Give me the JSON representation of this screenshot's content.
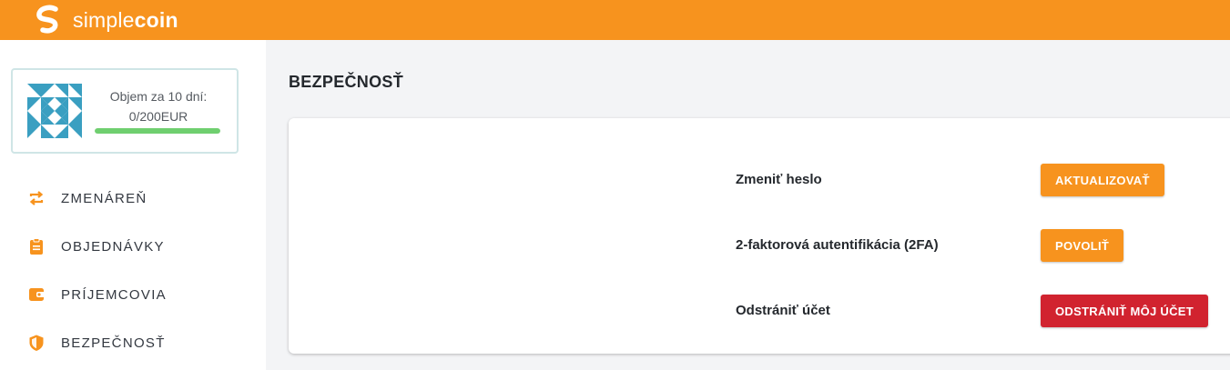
{
  "header": {
    "brand_light": "simple",
    "brand_bold": "coin",
    "accent_color": "#f7931e"
  },
  "account": {
    "volume_label": "Objem za 10 dní:",
    "volume_value": "0/200EUR",
    "volume_progress": 1.0
  },
  "sidebar": {
    "items": [
      {
        "label": "ZMENÁREŇ",
        "icon": "exchange-arrows-icon"
      },
      {
        "label": "OBJEDNÁVKY",
        "icon": "clipboard-icon"
      },
      {
        "label": "PRÍJEMCOVIA",
        "icon": "wallet-icon"
      },
      {
        "label": "BEZPEČNOSŤ",
        "icon": "shield-icon"
      }
    ]
  },
  "main": {
    "title": "BEZPEČNOSŤ",
    "rows": [
      {
        "label": "Zmeniť heslo",
        "button": "AKTUALIZOVAŤ",
        "button_color": "#f7931e"
      },
      {
        "label": "2-faktorová autentifikácia (2FA)",
        "button": "POVOLIŤ",
        "button_color": "#f7931e"
      },
      {
        "label": "Odstrániť účet",
        "button": "ODSTRÁNIŤ MÔJ ÚČET",
        "button_color": "#d1232f"
      }
    ]
  }
}
